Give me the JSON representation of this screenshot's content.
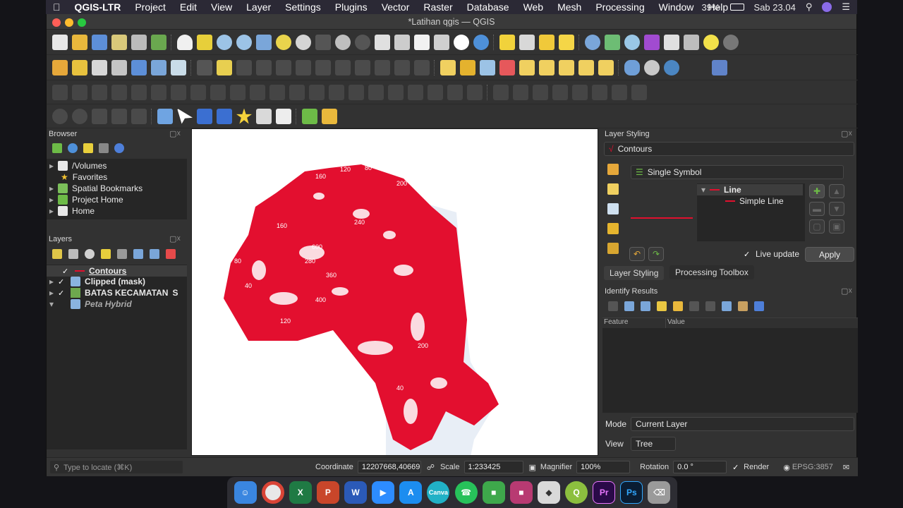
{
  "menubar": {
    "apple": "",
    "app_name": "QGIS-LTR",
    "items": [
      "Project",
      "Edit",
      "View",
      "Layer",
      "Settings",
      "Plugins",
      "Vector",
      "Raster",
      "Database",
      "Web",
      "Mesh",
      "Processing",
      "Window",
      "Help"
    ],
    "battery": "39%",
    "datetime": "Sab 23.04"
  },
  "window": {
    "title": "*Latihan qgis — QGIS"
  },
  "browser": {
    "title": "Browser",
    "items": [
      "/Volumes",
      "Favorites",
      "Spatial Bookmarks",
      "Project Home",
      "Home"
    ]
  },
  "layers": {
    "title": "Layers",
    "items": [
      {
        "name": "Contours",
        "checked": true
      },
      {
        "name": "Clipped (mask)",
        "checked": true
      },
      {
        "name": "BATAS KECAMATAN",
        "checked": true,
        "suffix": "S"
      },
      {
        "name": "Peta Hybrid",
        "checked": false
      }
    ]
  },
  "styling": {
    "title": "Layer Styling",
    "layer_combo": "Contours",
    "renderer_combo": "Single Symbol",
    "symbol_root": "Line",
    "symbol_child": "Simple Line",
    "live_update": "Live update",
    "apply": "Apply",
    "tabs": [
      "Layer Styling",
      "Processing Toolbox"
    ]
  },
  "identify": {
    "title": "Identify Results",
    "col_feature": "Feature",
    "col_value": "Value",
    "mode_label": "Mode",
    "mode_value": "Current Layer",
    "view_label": "View",
    "view_value": "Tree"
  },
  "status": {
    "locate_placeholder": "Type to locate (⌘K)",
    "coordinate_label": "Coordinate",
    "coordinate_value": "12207668,40669",
    "scale_label": "Scale",
    "scale_value": "1:233425",
    "magnifier_label": "Magnifier",
    "magnifier_value": "100%",
    "rotation_label": "Rotation",
    "rotation_value": "0.0 °",
    "render_label": "Render",
    "crs": "EPSG:3857"
  },
  "map_labels": [
    "160",
    "120",
    "80",
    "200",
    "280",
    "160",
    "240",
    "600",
    "360",
    "400",
    "120",
    "40",
    "80",
    "200",
    "40"
  ],
  "colors": {
    "contour_red": "#e0102e",
    "accent": "#3d6fd6"
  },
  "dock": [
    "Finder",
    "Chrome",
    "Excel",
    "PowerPoint",
    "Word",
    "Zoom",
    "App Store",
    "Canva",
    "WhatsApp",
    "Files",
    "WinRAR",
    "Virtual",
    "QGIS",
    "Premiere",
    "Photoshop",
    "Trash"
  ]
}
